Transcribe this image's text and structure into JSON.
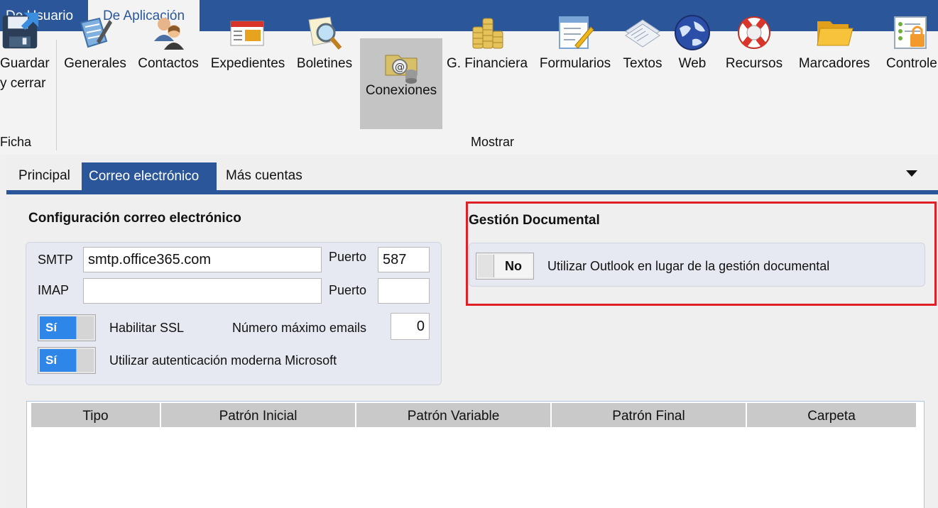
{
  "ribbon_tabs": [
    "De Usuario",
    "De Aplicación"
  ],
  "ribbon": {
    "save": {
      "line1": "Guardar",
      "line2": "y cerrar"
    },
    "group_ficha": "Ficha",
    "group_mostrar": "Mostrar",
    "buttons": [
      {
        "label": "Generales",
        "icon": "generales-icon"
      },
      {
        "label": "Contactos",
        "icon": "contacts-icon"
      },
      {
        "label": "Expedientes",
        "icon": "expedientes-icon"
      },
      {
        "label": "Boletines",
        "icon": "boletines-icon"
      },
      {
        "label": "Conexiones",
        "icon": "conexiones-icon"
      },
      {
        "label": "G. Financiera",
        "icon": "coins-icon"
      },
      {
        "label": "Formularios",
        "icon": "form-icon"
      },
      {
        "label": "Textos",
        "icon": "textos-icon"
      },
      {
        "label": "Web",
        "icon": "globe-icon"
      },
      {
        "label": "Recursos",
        "icon": "lifebuoy-icon"
      },
      {
        "label": "Marcadores",
        "icon": "folder-icon"
      },
      {
        "label": "Controle",
        "icon": "controls-icon"
      }
    ]
  },
  "form_tabs": [
    "Principal",
    "Correo electrónico",
    "Más cuentas"
  ],
  "email_config": {
    "title": "Configuración correo electrónico",
    "smtp_label": "SMTP",
    "smtp_value": "smtp.office365.com",
    "smtp_port_label": "Puerto",
    "smtp_port_value": "587",
    "imap_label": "IMAP",
    "imap_value": "",
    "imap_port_label": "Puerto",
    "imap_port_value": "",
    "ssl_toggle": "Sí",
    "ssl_label": "Habilitar SSL",
    "max_emails_label": "Número máximo emails",
    "max_emails_value": "0",
    "modern_auth_toggle": "Sí",
    "modern_auth_label": "Utilizar autenticación moderna Microsoft"
  },
  "doc_management": {
    "title": "Gestión Documental",
    "toggle": "No",
    "label": "Utilizar Outlook en lugar de la gestión documental"
  },
  "table": {
    "columns": [
      "Tipo",
      "Patrón Inicial",
      "Patrón Variable",
      "Patrón Final",
      "Carpeta"
    ]
  },
  "colors": {
    "accent": "#2b579a",
    "toggle_on": "#2e86e8",
    "highlight_border": "#e02027"
  }
}
